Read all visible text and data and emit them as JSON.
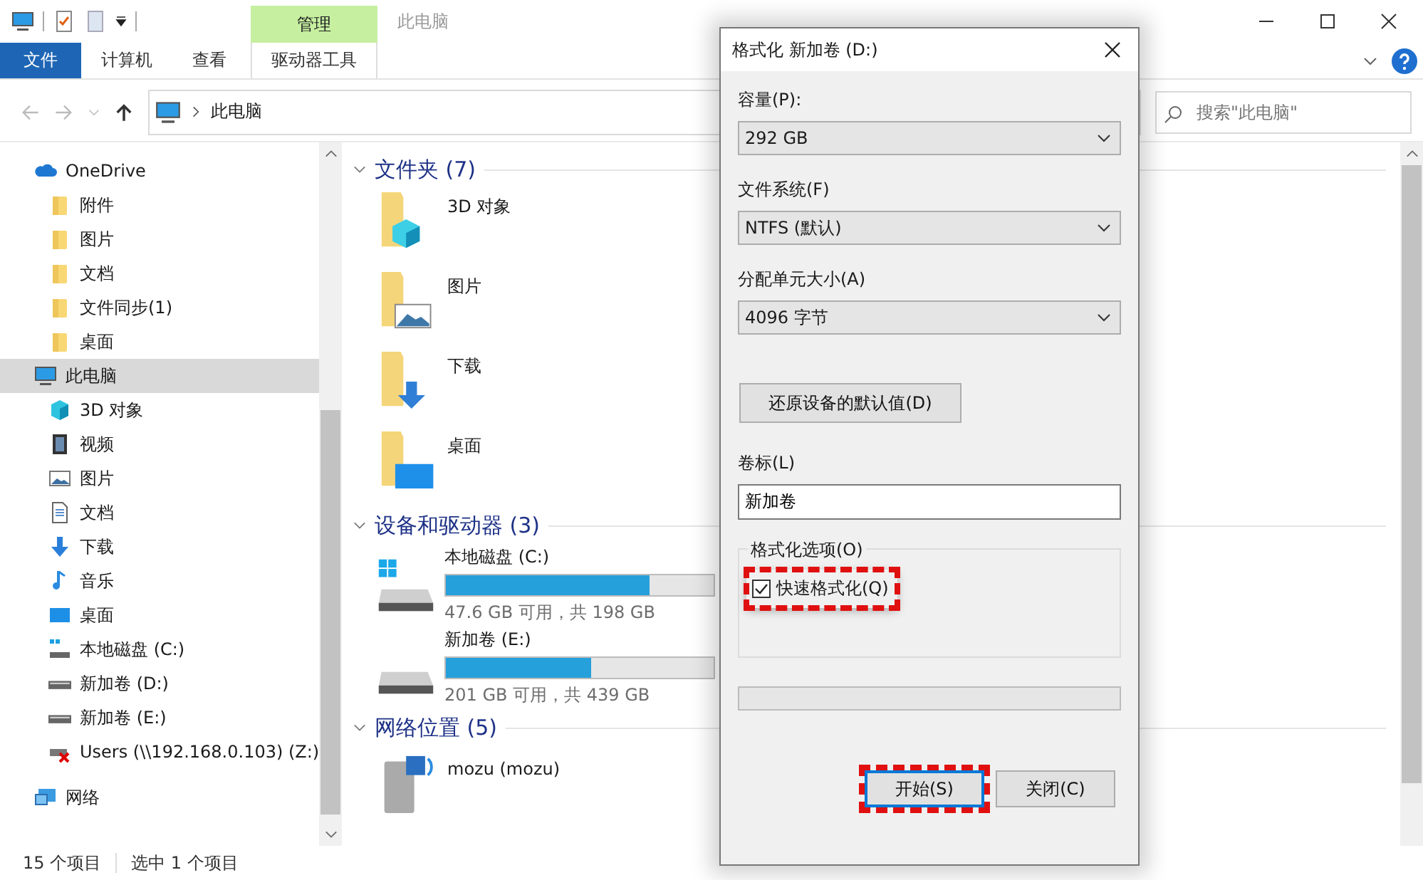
{
  "window": {
    "title": "此电脑",
    "context_tab": "管理"
  },
  "ribbon_tabs": [
    {
      "label": "文件",
      "kind": "file"
    },
    {
      "label": "计算机",
      "kind": "tab"
    },
    {
      "label": "查看",
      "kind": "tab"
    },
    {
      "label": "驱动器工具",
      "kind": "context"
    }
  ],
  "address": {
    "path": "此电脑"
  },
  "search": {
    "placeholder": "搜索\"此电脑\""
  },
  "sidebar": {
    "items": [
      {
        "label": "OneDrive",
        "kind": "cloud",
        "selected": false,
        "children": [
          {
            "label": "附件",
            "kind": "folder",
            "selected": false
          },
          {
            "label": "图片",
            "kind": "folder",
            "selected": false
          },
          {
            "label": "文档",
            "kind": "folder",
            "selected": false
          },
          {
            "label": "文件同步(1)",
            "kind": "folder",
            "selected": false
          },
          {
            "label": "桌面",
            "kind": "folder",
            "selected": false
          }
        ]
      },
      {
        "label": "此电脑",
        "kind": "pc",
        "selected": true,
        "children": [
          {
            "label": "3D 对象",
            "kind": "cube",
            "selected": false
          },
          {
            "label": "视频",
            "kind": "video",
            "selected": false
          },
          {
            "label": "图片",
            "kind": "image",
            "selected": false
          },
          {
            "label": "文档",
            "kind": "doc",
            "selected": false
          },
          {
            "label": "下载",
            "kind": "download",
            "selected": false
          },
          {
            "label": "音乐",
            "kind": "music",
            "selected": false
          },
          {
            "label": "桌面",
            "kind": "desktop",
            "selected": false
          },
          {
            "label": "本地磁盘 (C:)",
            "kind": "drive-win",
            "selected": false
          },
          {
            "label": "新加卷 (D:)",
            "kind": "drive",
            "selected": false
          },
          {
            "label": "新加卷 (E:)",
            "kind": "drive",
            "selected": false
          },
          {
            "label": "Users (\\\\192.168.0.103) (Z:)",
            "kind": "netdrive",
            "selected": false
          }
        ]
      },
      {
        "label": "网络",
        "kind": "network",
        "selected": false
      }
    ]
  },
  "sections": [
    {
      "title": "文件夹 (7)",
      "kind": "folders",
      "items": [
        {
          "name": "3D 对象",
          "kind": "cube"
        },
        {
          "name": "图片",
          "kind": "image"
        },
        {
          "name": "下载",
          "kind": "download"
        },
        {
          "name": "桌面",
          "kind": "desktop"
        }
      ]
    },
    {
      "title": "设备和驱动器 (3)",
      "kind": "drives",
      "items": [
        {
          "name": "本地磁盘 (C:)",
          "kind": "drive-win",
          "level": 0.76,
          "free": "47.6 GB 可用，共 198 GB"
        },
        {
          "name": "新加卷 (E:)",
          "kind": "drive",
          "level": 0.54,
          "free": "201 GB 可用，共 439 GB"
        }
      ]
    },
    {
      "title": "网络位置 (5)",
      "kind": "network",
      "items": [
        {
          "name": "mozu (mozu)",
          "kind": "media"
        }
      ]
    }
  ],
  "status_bar": {
    "count": "15 个项目",
    "selection": "选中 1 个项目"
  },
  "dialog": {
    "title": "格式化 新加卷 (D:)",
    "selects": [
      {
        "label": "容量(P):",
        "value": "292 GB"
      },
      {
        "label": "文件系统(F)",
        "value": "NTFS (默认)"
      },
      {
        "label": "分配单元大小(A)",
        "value": "4096 字节"
      }
    ],
    "restore_button": "还原设备的默认值(D)",
    "volume_label": {
      "label": "卷标(L)",
      "value": "新加卷"
    },
    "options": {
      "legend": "格式化选项(O)",
      "quick_format": {
        "label": "快速格式化(Q)",
        "checked": true,
        "highlighted": true
      }
    },
    "progress": {
      "level": 0
    },
    "buttons": [
      {
        "label": "开始(S)",
        "kind": "primary",
        "highlighted": true
      },
      {
        "label": "关闭(C)",
        "kind": "normal",
        "highlighted": false
      }
    ]
  }
}
